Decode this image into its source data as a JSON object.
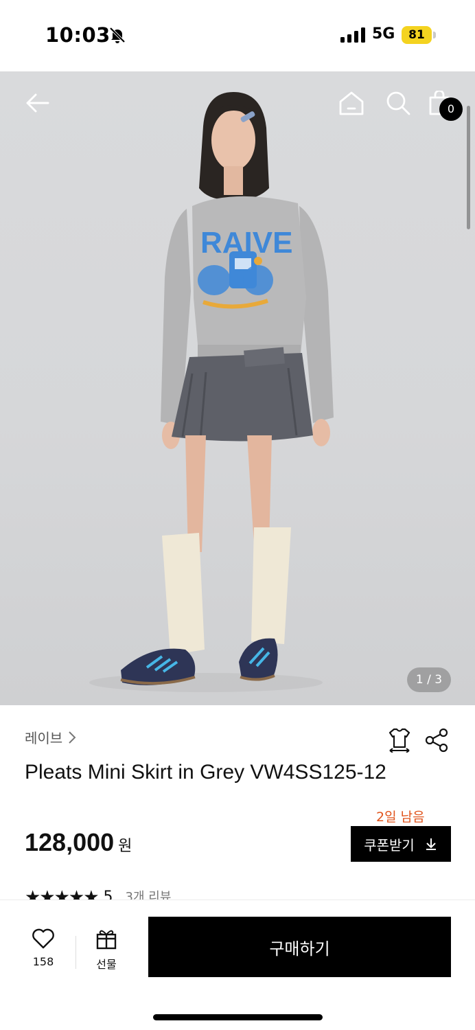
{
  "status_bar": {
    "time": "10:03",
    "network": "5G",
    "battery_level": "81",
    "icons": [
      "bell-slash-icon",
      "signal-icon",
      "battery-icon"
    ]
  },
  "hero": {
    "pager": "1 / 3",
    "cart_count": "0",
    "icons": [
      "back-arrow-icon",
      "home-icon",
      "search-icon",
      "shopping-bag-icon"
    ],
    "image": "model-photo",
    "colors": {
      "background": "#d7d8da",
      "sweatshirt": "#b9b9ba",
      "skirt": "#5e6068",
      "print": "#3f88d8"
    }
  },
  "product": {
    "brand": "레이브",
    "title": "Pleats Mini Skirt in Grey VW4SS125-12",
    "price": "128,000",
    "currency": "원",
    "coupon_deadline": "2일 남음",
    "coupon_label": "쿠폰받기",
    "rating": "5",
    "review_count": "3개 리뷰",
    "icons": [
      "size-guide-icon",
      "share-icon",
      "download-icon"
    ]
  },
  "bottom_bar": {
    "like_count": "158",
    "gift_label": "선물",
    "buy_label": "구매하기",
    "icons": [
      "heart-icon",
      "gift-icon"
    ]
  },
  "colors": {
    "accent_orange": "#e0531b",
    "primary_black": "#000000"
  }
}
